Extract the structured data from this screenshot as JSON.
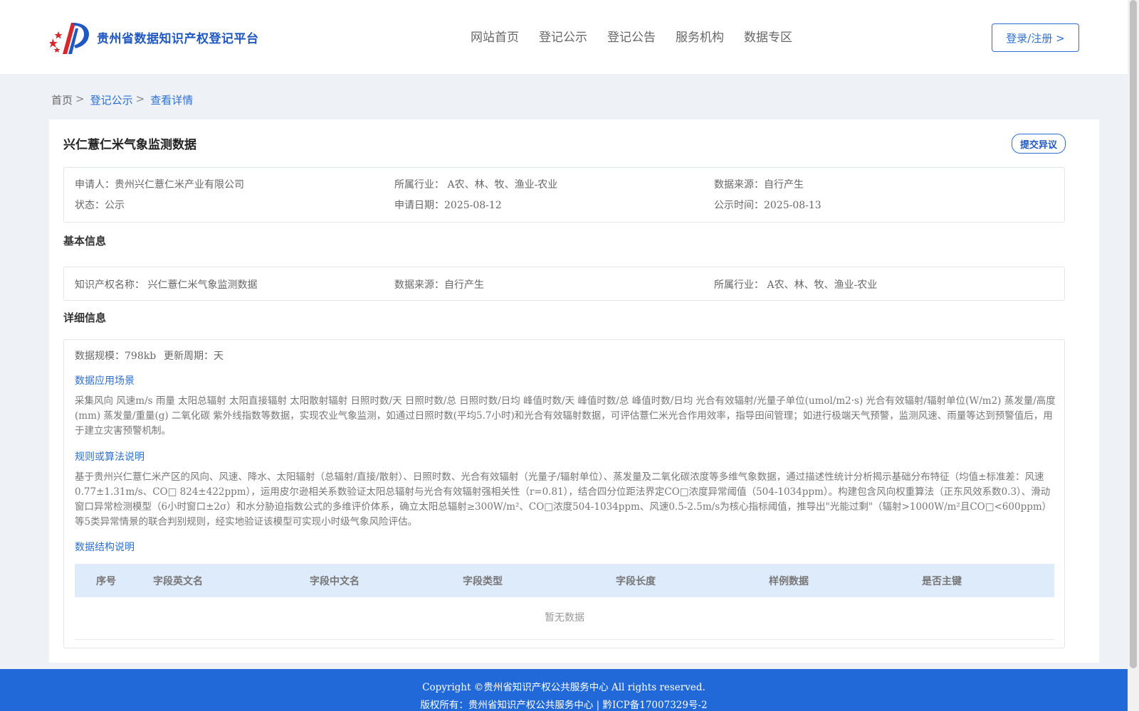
{
  "site": {
    "name": "贵州省数据知识产权登记平台"
  },
  "nav": [
    "网站首页",
    "登记公示",
    "登记公告",
    "服务机构",
    "数据专区"
  ],
  "login_label": "登录/注册 >",
  "breadcrumb": {
    "home": "首页",
    "list": "登记公示",
    "current": "查看详情",
    "sep": ">"
  },
  "detail": {
    "title": "兴仁薏仁米气象监测数据",
    "objection_label": "提交异议",
    "summary": {
      "applicant_label": "申请人：",
      "applicant": "贵州兴仁薏仁米产业有限公司",
      "industry_label": "所属行业：",
      "industry": "A农、林、牧、渔业-农业",
      "source_label": "数据来源：",
      "source": "自行产生",
      "status_label": "状态：",
      "status": "公示",
      "apply_date_label": "申请日期：",
      "apply_date": "2025-08-12",
      "publish_date_label": "公示时间：",
      "publish_date": "2025-08-13"
    },
    "basic": {
      "section_title": "基本信息",
      "ip_name_label": "知识产权名称：",
      "ip_name": "兴仁薏仁米气象监测数据",
      "source_label": "数据来源：",
      "source": "自行产生",
      "industry_label": "所属行业：",
      "industry": "A农、林、牧、渔业-农业"
    },
    "details": {
      "section_title": "详细信息",
      "scale_label": "数据规模：",
      "scale": "798kb",
      "cycle_label": "更新周期：",
      "cycle": "天",
      "scenario_title": "数据应用场景",
      "scenario_text": "采集风向 风速m/s 雨量 太阳总辐射 太阳直接辐射 太阳散射辐射 日照时数/天 日照时数/总 日照时数/日均 峰值时数/天 峰值时数/总 峰值时数/日均 光合有效辐射/光量子单位(umol/m2·s) 光合有效辐射/辐射单位(W/m2) 蒸发量/高度(mm) 蒸发量/重量(g) 二氧化碳 紫外线指数等数据，实现农业气象监测，如通过日照时数(平均5.7小时)和光合有效辐射数据，可评估薏仁米光合作用效率，指导田间管理；如进行极端天气预警，监测风速、雨量等达到预警值后，用于建立灾害预警机制。",
      "algorithm_title": "规则或算法说明",
      "algorithm_text": "基于贵州兴仁薏仁米产区的风向、风速、降水、太阳辐射（总辐射/直接/散射）、日照时数、光合有效辐射（光量子/辐射单位）、蒸发量及二氧化碳浓度等多维气象数据，通过描述性统计分析揭示基础分布特征（均值±标准差：风速0.77±1.31m/s、CO□ 824±422ppm），运用皮尔逊相关系数验证太阳总辐射与光合有效辐射强相关性（r=0.81），结合四分位距法界定CO□浓度异常阈值（504-1034ppm）。构建包含风向权重算法（正东风效系数0.3）、滑动窗口异常检测模型（6小时窗口±2σ）和水分胁迫指数公式的多维评价体系，确立太阳总辐射≥300W/m²、CO□浓度504-1034ppm、风速0.5-2.5m/s为核心指标阈值，推导出\"光能过剩\"（辐射>1000W/m²且CO□<600ppm）等5类异常情景的联合判别规则，经实地验证该模型可实现小时级气象风险评估。",
      "structure_title": "数据结构说明",
      "table_headers": [
        "序号",
        "字段英文名",
        "字段中文名",
        "字段类型",
        "字段长度",
        "样例数据",
        "是否主键"
      ],
      "empty_text": "暂无数据"
    }
  },
  "footer": {
    "copyright": "Copyright ©贵州省知识产权公共服务中心 All rights reserved.",
    "owner": "版权所有：贵州省知识产权公共服务中心 | 黔ICP备17007329号-2"
  }
}
